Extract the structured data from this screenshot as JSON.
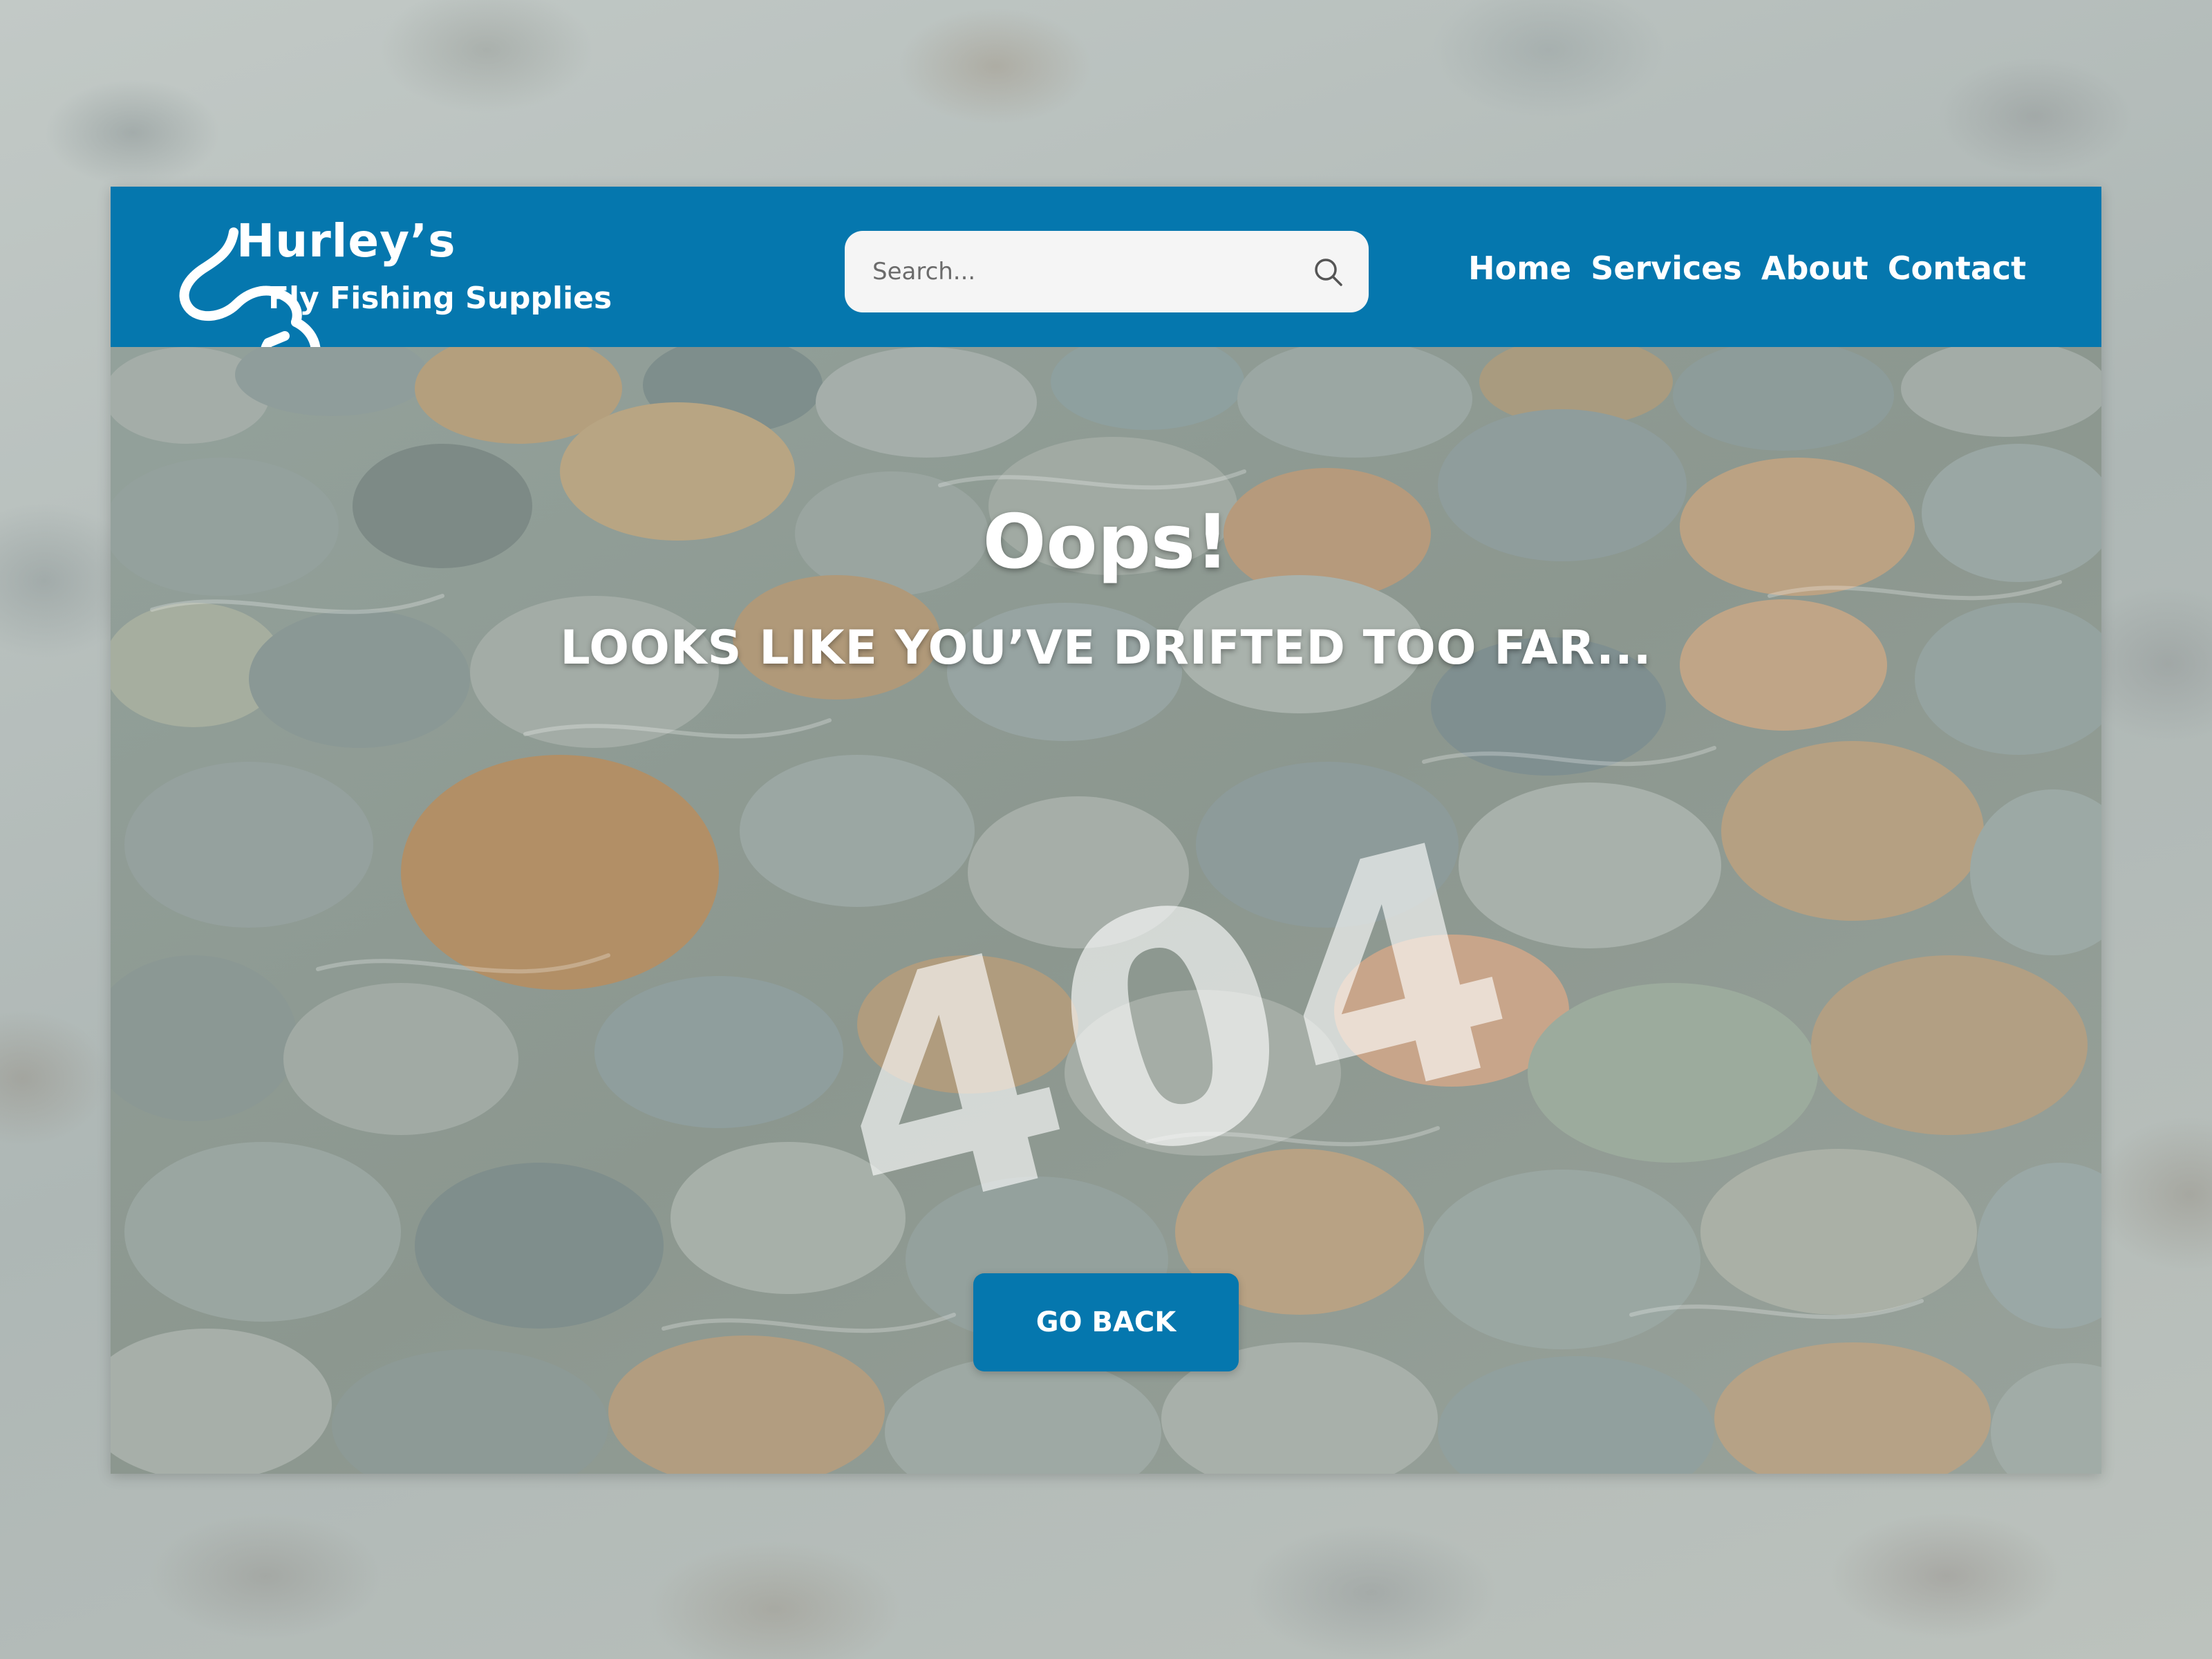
{
  "brand": {
    "name": "Hurley’s",
    "tagline": "Fly Fishing Supplies",
    "logo_icon": "fishing-hook-icon"
  },
  "search": {
    "placeholder": "Search...",
    "icon": "search-icon"
  },
  "nav": {
    "items": [
      {
        "label": "Home"
      },
      {
        "label": "Services"
      },
      {
        "label": "About"
      },
      {
        "label": "Contact"
      }
    ]
  },
  "error": {
    "heading": "Oops!",
    "message": "LOOKS LIKE YOU’VE DRIFTED TOO FAR...",
    "code": "404"
  },
  "actions": {
    "go_back_label": "GO BACK"
  },
  "colors": {
    "brand_blue": "#0577ae",
    "text_light": "#ffffff",
    "search_bg": "#f5f5f5"
  }
}
